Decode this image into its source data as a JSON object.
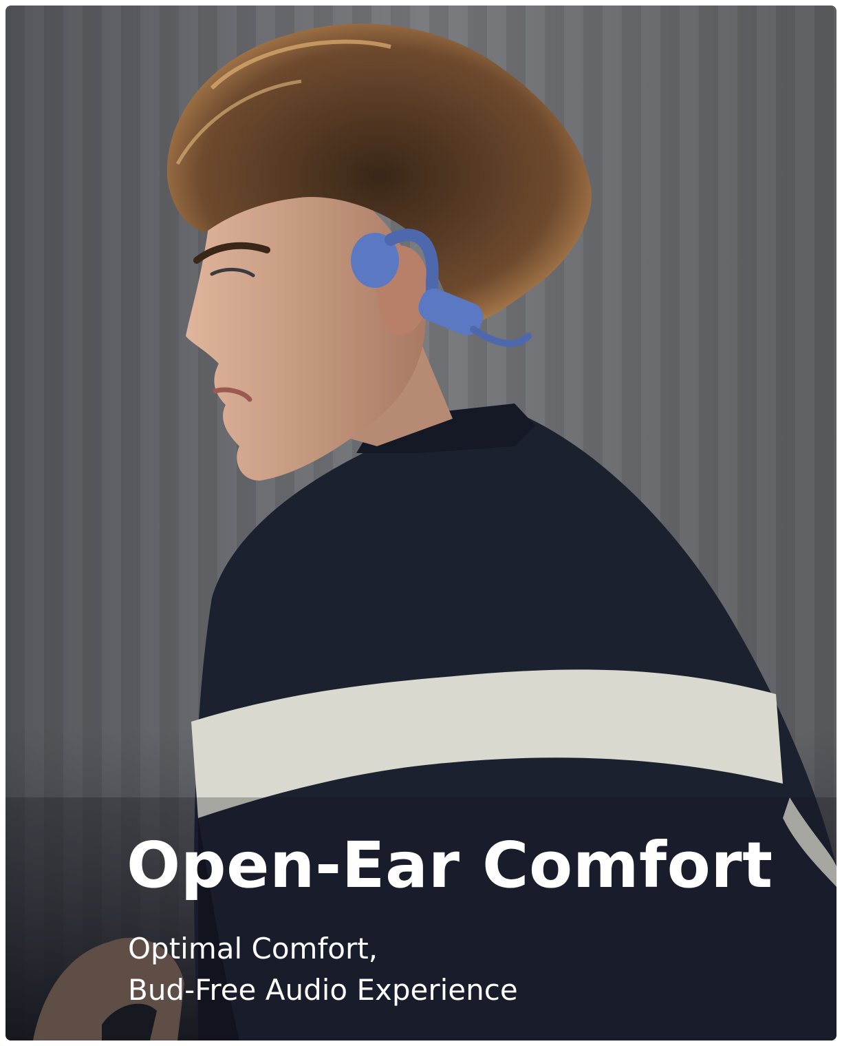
{
  "headline": "Open-Ear Comfort",
  "subline_1": "Optimal Comfort,",
  "subline_2": "Bud-Free Audio Experience",
  "colors": {
    "background_wall": "#6b6d72",
    "jacket_navy": "#1c2130",
    "jacket_stripe": "#d9d9cf",
    "hair": "#6e4a2e",
    "skin": "#c99a82",
    "headphone_blue": "#5b78c2",
    "text": "#ffffff"
  },
  "icons": [
    "open-ear-headphone"
  ]
}
